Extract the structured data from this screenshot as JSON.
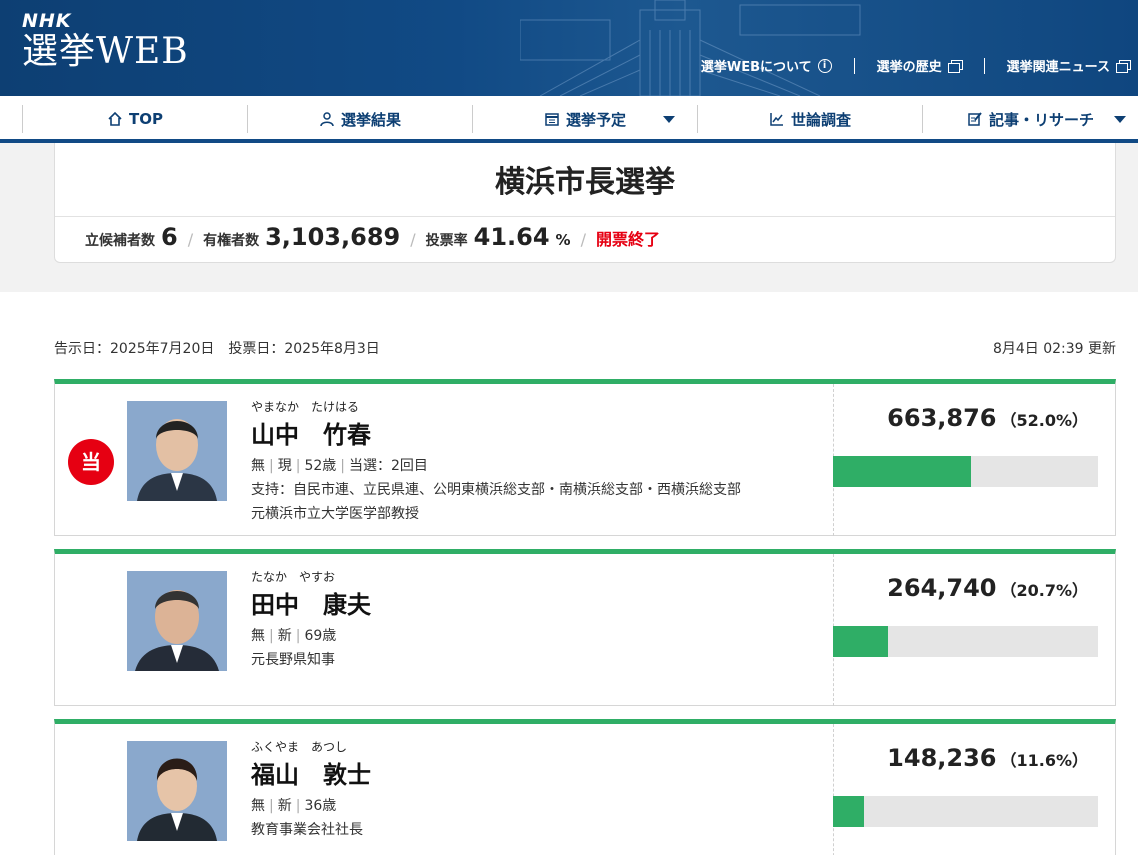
{
  "header": {
    "brand": "NHK",
    "site_title": "選挙WEB",
    "links": [
      {
        "label": "選挙WEBについて",
        "icon": "info-icon"
      },
      {
        "label": "選挙の歴史",
        "icon": "external-window-icon"
      },
      {
        "label": "選挙関連ニュース",
        "icon": "external-window-icon"
      }
    ]
  },
  "nav": {
    "items": [
      {
        "label": "TOP",
        "icon": "home-icon"
      },
      {
        "label": "選挙結果",
        "icon": "person-icon"
      },
      {
        "label": "選挙予定",
        "icon": "calendar-icon",
        "dropdown": true
      },
      {
        "label": "世論調査",
        "icon": "chart-line-icon"
      },
      {
        "label": "記事・リサーチ",
        "icon": "article-edit-icon",
        "dropdown": true
      }
    ]
  },
  "summary": {
    "title": "横浜市長選挙",
    "candidates_label": "立候補者数",
    "candidates_value": "6",
    "voters_label": "有権者数",
    "voters_value": "3,103,689",
    "turnout_label": "投票率",
    "turnout_value": "41.64",
    "turnout_unit": "%",
    "status": "開票終了"
  },
  "dates": {
    "announce": "告示日：2025年7月20日　投票日：2025年8月3日",
    "updated": "8月4日 02:39 更新"
  },
  "colors": {
    "accent": "#2fae66",
    "navy": "#114a85",
    "red": "#e60012"
  },
  "candidates": [
    {
      "kana": "やまなか　たけはる",
      "name": "山中　竹春",
      "winner": true,
      "winner_badge": "当",
      "party": "無",
      "status": "現",
      "age": "52歳",
      "elected": "当選：2回目",
      "support": "支持：自民市連、立民県連、公明東横浜総支部・南横浜総支部・西横浜総支部",
      "title": "元横浜市立大学医学部教授",
      "votes": "663,876",
      "pct_label": "（52.0%）",
      "share": 0.52
    },
    {
      "kana": "たなか　やすお",
      "name": "田中　康夫",
      "winner": false,
      "party": "無",
      "status": "新",
      "age": "69歳",
      "title": "元長野県知事",
      "votes": "264,740",
      "pct_label": "（20.7%）",
      "share": 0.207
    },
    {
      "kana": "ふくやま　あつし",
      "name": "福山　敦士",
      "winner": false,
      "party": "無",
      "status": "新",
      "age": "36歳",
      "title": "教育事業会社社長",
      "votes": "148,236",
      "pct_label": "（11.6%）",
      "share": 0.116
    }
  ]
}
